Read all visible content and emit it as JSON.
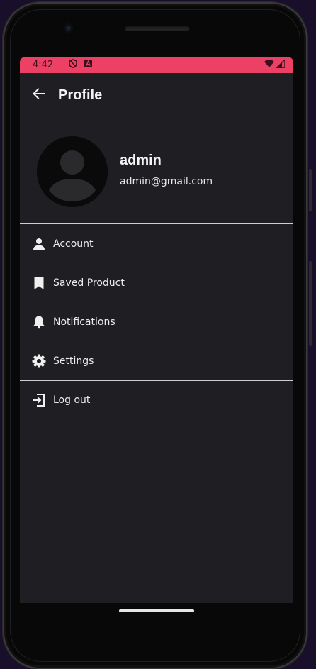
{
  "status_bar": {
    "time": "4:42",
    "background": "#ec4064",
    "icons": [
      "shield-icon",
      "a-badge-icon",
      "wifi-icon",
      "signal-icon"
    ]
  },
  "app_bar": {
    "title": "Profile",
    "back_icon": "arrow-left-icon"
  },
  "profile": {
    "name": "admin",
    "email": "admin@gmail.com",
    "avatar_icon": "person-avatar-icon"
  },
  "menu": {
    "items": [
      {
        "label": "Account",
        "icon": "person-icon"
      },
      {
        "label": "Saved Product",
        "icon": "bookmark-icon"
      },
      {
        "label": "Notifications",
        "icon": "bell-icon"
      },
      {
        "label": "Settings",
        "icon": "gear-icon"
      }
    ],
    "logout": {
      "label": "Log out",
      "icon": "logout-icon"
    }
  },
  "colors": {
    "screen_background": "#1f1e22",
    "text": "#ececec",
    "divider": "#cfcfcf"
  }
}
